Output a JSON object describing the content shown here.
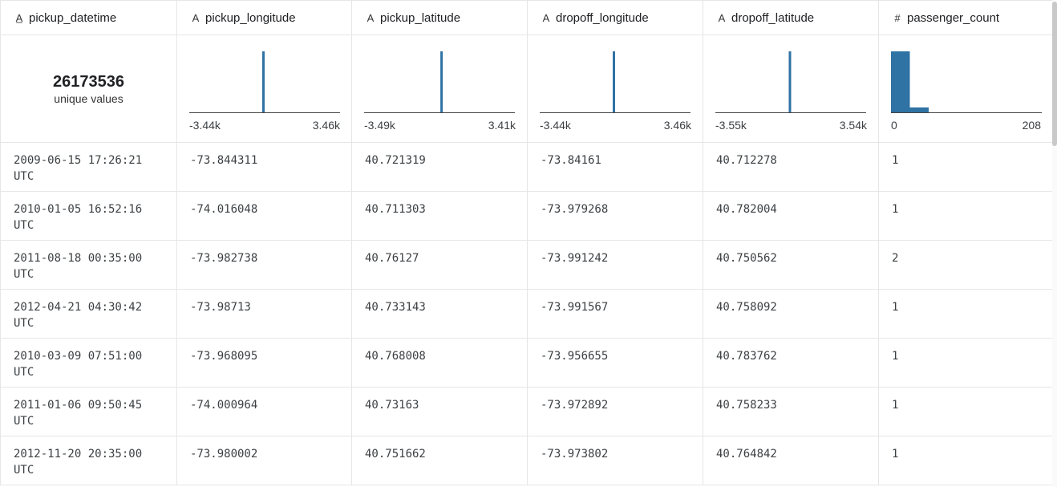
{
  "columns": [
    {
      "name": "pickup_datetime",
      "icon": "string-type-icon"
    },
    {
      "name": "pickup_longitude",
      "icon": "string-type-icon"
    },
    {
      "name": "pickup_latitude",
      "icon": "string-type-icon"
    },
    {
      "name": "dropoff_longitude",
      "icon": "string-type-icon"
    },
    {
      "name": "dropoff_latitude",
      "icon": "string-type-icon"
    },
    {
      "name": "passenger_count",
      "icon": "numeric-type-icon"
    }
  ],
  "summary": {
    "pickup_datetime": {
      "count": "26173536",
      "caption": "unique values"
    },
    "pickup_longitude": {
      "min": "-3.44k",
      "max": "3.46k"
    },
    "pickup_latitude": {
      "min": "-3.49k",
      "max": "3.41k"
    },
    "dropoff_longitude": {
      "min": "-3.44k",
      "max": "3.46k"
    },
    "dropoff_latitude": {
      "min": "-3.55k",
      "max": "3.54k"
    },
    "passenger_count": {
      "min": "0",
      "max": "208"
    }
  },
  "chart_data": [
    {
      "type": "bar",
      "column": "pickup_longitude",
      "xlim": [
        -3440,
        3460
      ],
      "bins": [
        {
          "x0": -100,
          "x1": 0,
          "relative_height": 1.0
        }
      ]
    },
    {
      "type": "bar",
      "column": "pickup_latitude",
      "xlim": [
        -3490,
        3410
      ],
      "bins": [
        {
          "x0": 0,
          "x1": 100,
          "relative_height": 1.0
        }
      ]
    },
    {
      "type": "bar",
      "column": "dropoff_longitude",
      "xlim": [
        -3440,
        3460
      ],
      "bins": [
        {
          "x0": -100,
          "x1": 0,
          "relative_height": 1.0
        }
      ]
    },
    {
      "type": "bar",
      "column": "dropoff_latitude",
      "xlim": [
        -3550,
        3540
      ],
      "bins": [
        {
          "x0": -100,
          "x1": 0,
          "relative_height": 1.0
        }
      ]
    },
    {
      "type": "bar",
      "column": "passenger_count",
      "xlim": [
        0,
        208
      ],
      "bins": [
        {
          "x0": 0,
          "x1": 26,
          "relative_height": 1.0
        },
        {
          "x0": 26,
          "x1": 52,
          "relative_height": 0.08
        }
      ]
    }
  ],
  "bar_color": "#2f72a4",
  "rows": [
    {
      "pickup_datetime": "2009-06-15 17:26:21 UTC",
      "pickup_longitude": "-73.844311",
      "pickup_latitude": "40.721319",
      "dropoff_longitude": "-73.84161",
      "dropoff_latitude": "40.712278",
      "passenger_count": "1"
    },
    {
      "pickup_datetime": "2010-01-05 16:52:16 UTC",
      "pickup_longitude": "-74.016048",
      "pickup_latitude": "40.711303",
      "dropoff_longitude": "-73.979268",
      "dropoff_latitude": "40.782004",
      "passenger_count": "1"
    },
    {
      "pickup_datetime": "2011-08-18 00:35:00 UTC",
      "pickup_longitude": "-73.982738",
      "pickup_latitude": "40.76127",
      "dropoff_longitude": "-73.991242",
      "dropoff_latitude": "40.750562",
      "passenger_count": "2"
    },
    {
      "pickup_datetime": "2012-04-21 04:30:42 UTC",
      "pickup_longitude": "-73.98713",
      "pickup_latitude": "40.733143",
      "dropoff_longitude": "-73.991567",
      "dropoff_latitude": "40.758092",
      "passenger_count": "1"
    },
    {
      "pickup_datetime": "2010-03-09 07:51:00 UTC",
      "pickup_longitude": "-73.968095",
      "pickup_latitude": "40.768008",
      "dropoff_longitude": "-73.956655",
      "dropoff_latitude": "40.783762",
      "passenger_count": "1"
    },
    {
      "pickup_datetime": "2011-01-06 09:50:45 UTC",
      "pickup_longitude": "-74.000964",
      "pickup_latitude": "40.73163",
      "dropoff_longitude": "-73.972892",
      "dropoff_latitude": "40.758233",
      "passenger_count": "1"
    },
    {
      "pickup_datetime": "2012-11-20 20:35:00 UTC",
      "pickup_longitude": "-73.980002",
      "pickup_latitude": "40.751662",
      "dropoff_longitude": "-73.973802",
      "dropoff_latitude": "40.764842",
      "passenger_count": "1"
    }
  ]
}
